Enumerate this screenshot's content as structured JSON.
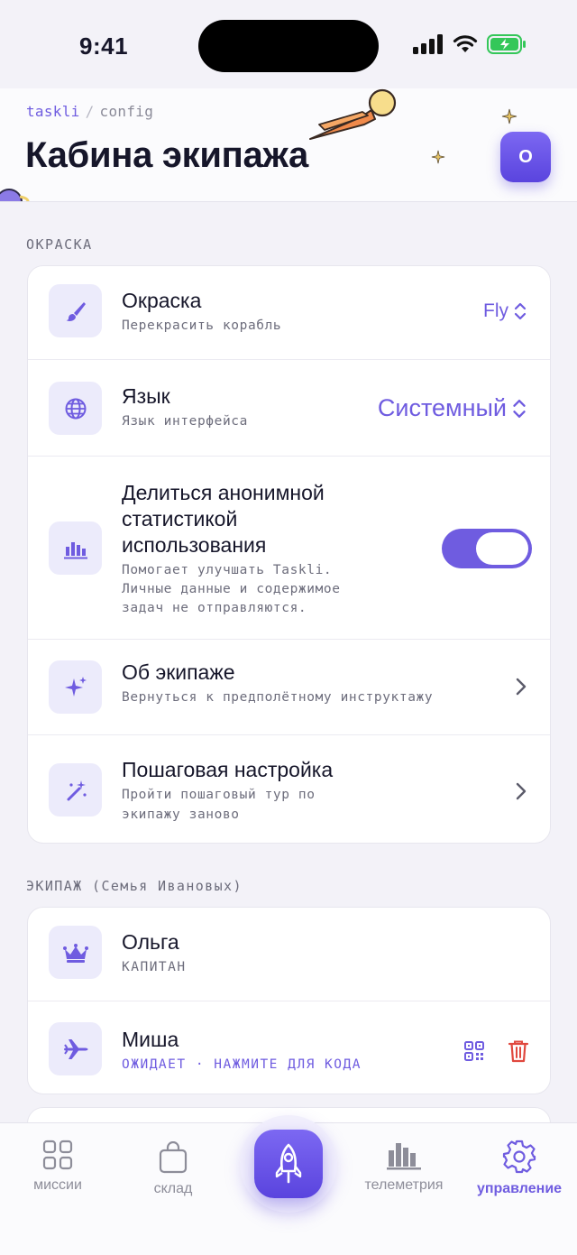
{
  "status": {
    "time": "9:41"
  },
  "header": {
    "breadcrumb": [
      "taskli",
      "config"
    ],
    "title": "Кабина экипажа",
    "avatar_initial": "О"
  },
  "appearance": {
    "section_label": "ОКРАСКА",
    "items": [
      {
        "title": "Окраска",
        "subtitle": "Перекрасить корабль",
        "value": "Fly",
        "icon": "brush-icon"
      },
      {
        "title": "Язык",
        "subtitle": "Язык интерфейса",
        "value": "Системный",
        "icon": "globe-icon"
      },
      {
        "title_lines": [
          "Делиться анонимной",
          "статистикой",
          "использования"
        ],
        "subtitle_lines": [
          "Помогает улучшать Taskli.",
          "Личные данные и содержимое",
          "задач не отправляются."
        ],
        "toggle_on": true,
        "icon": "chart-icon"
      },
      {
        "title": "Об экипаже",
        "subtitle": "Вернуться к предполётному инструктажу",
        "icon": "sparkle-icon"
      },
      {
        "title": "Пошаговая настройка",
        "subtitle_lines": [
          "Пройти пошаговый тур по",
          "экипажу заново"
        ],
        "icon": "magic-wand-icon"
      }
    ]
  },
  "crew": {
    "section_label": "ЭКИПАЖ (Семья Ивановых)",
    "members": [
      {
        "name": "Ольга",
        "role": "КАПИТАН",
        "icon": "crown-icon"
      },
      {
        "name": "Миша",
        "status": "ОЖИДАЕТ · НАЖМИТЕ ДЛЯ КОДА",
        "icon": "plane-icon"
      }
    ]
  },
  "tabbar": {
    "tabs": [
      {
        "label": "миссии",
        "icon": "grid-icon"
      },
      {
        "label": "склад",
        "icon": "bag-icon"
      },
      {
        "label": "телеметрия",
        "icon": "bars-icon"
      },
      {
        "label": "управление",
        "icon": "gear-icon",
        "active": true
      }
    ],
    "center_icon": "rocket-icon"
  },
  "colors": {
    "accent": "#6f5ce0",
    "danger": "#e0483e",
    "background": "#f3f2f8"
  }
}
